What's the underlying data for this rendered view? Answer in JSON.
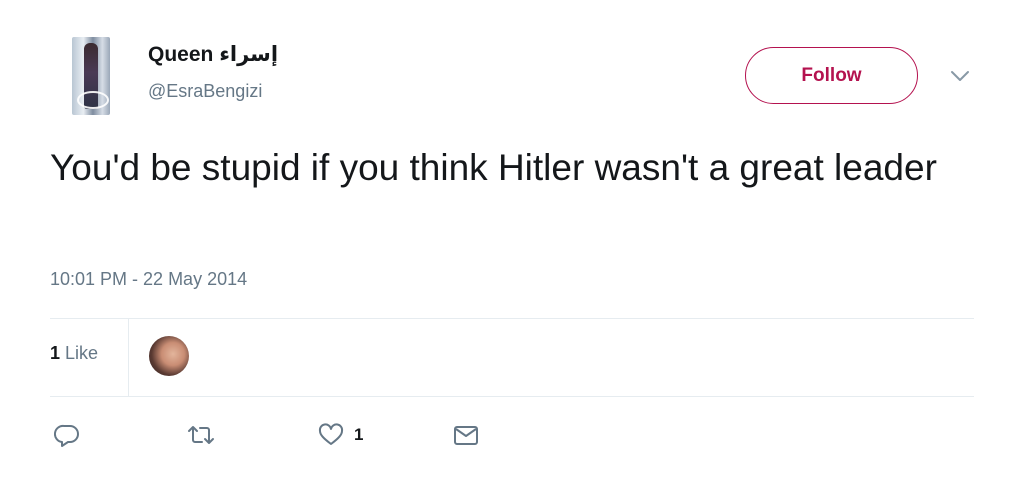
{
  "author": {
    "display_name": "Queen إسراء",
    "handle": "@EsraBengizi"
  },
  "follow_button": {
    "label": "Follow"
  },
  "tweet": {
    "text": "You'd be stupid if you think Hitler wasn't a great leader",
    "timestamp": "10:01 PM - 22 May 2014"
  },
  "stats": {
    "likes_count": "1",
    "likes_label": "Like"
  },
  "actions": {
    "like_count": "1",
    "icons": [
      "reply-icon",
      "retweet-icon",
      "like-icon",
      "direct-message-icon"
    ]
  },
  "colors": {
    "accent": "#b4124f",
    "text": "#14171a",
    "muted": "#657786",
    "divider": "#e6ecf0"
  }
}
